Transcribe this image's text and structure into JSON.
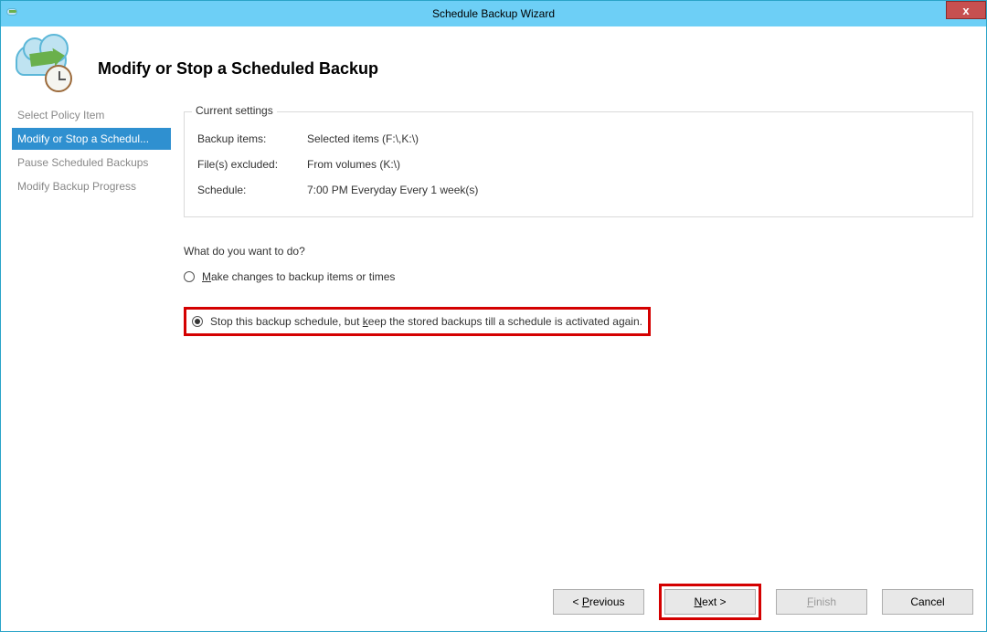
{
  "window": {
    "title": "Schedule Backup Wizard",
    "close_label": "x"
  },
  "header": {
    "title": "Modify or Stop a Scheduled Backup"
  },
  "sidebar": {
    "items": [
      {
        "label": "Select Policy Item",
        "selected": false
      },
      {
        "label": "Modify or Stop a Schedul...",
        "selected": true
      },
      {
        "label": "Pause Scheduled Backups",
        "selected": false
      },
      {
        "label": "Modify Backup Progress",
        "selected": false
      }
    ]
  },
  "settings": {
    "legend": "Current settings",
    "backup_items_label": "Backup items:",
    "backup_items_value": "Selected items (F:\\,K:\\)",
    "files_excluded_label": "File(s) excluded:",
    "files_excluded_value": "From volumes (K:\\)",
    "schedule_label": "Schedule:",
    "schedule_value": "7:00 PM Everyday Every 1 week(s)"
  },
  "prompt": "What do you want to do?",
  "options": {
    "make_changes_prefix": "",
    "make_changes_ul": "M",
    "make_changes_suffix": "ake changes to backup items or times",
    "stop_prefix": "Stop this backup schedule, but ",
    "stop_ul": "k",
    "stop_suffix": "eep the stored backups till a schedule is activated again.",
    "selected": "stop"
  },
  "buttons": {
    "previous_prefix": "< ",
    "previous_ul": "P",
    "previous_suffix": "revious",
    "next_ul": "N",
    "next_suffix": "ext >",
    "finish_ul": "F",
    "finish_suffix": "inish",
    "cancel": "Cancel"
  }
}
